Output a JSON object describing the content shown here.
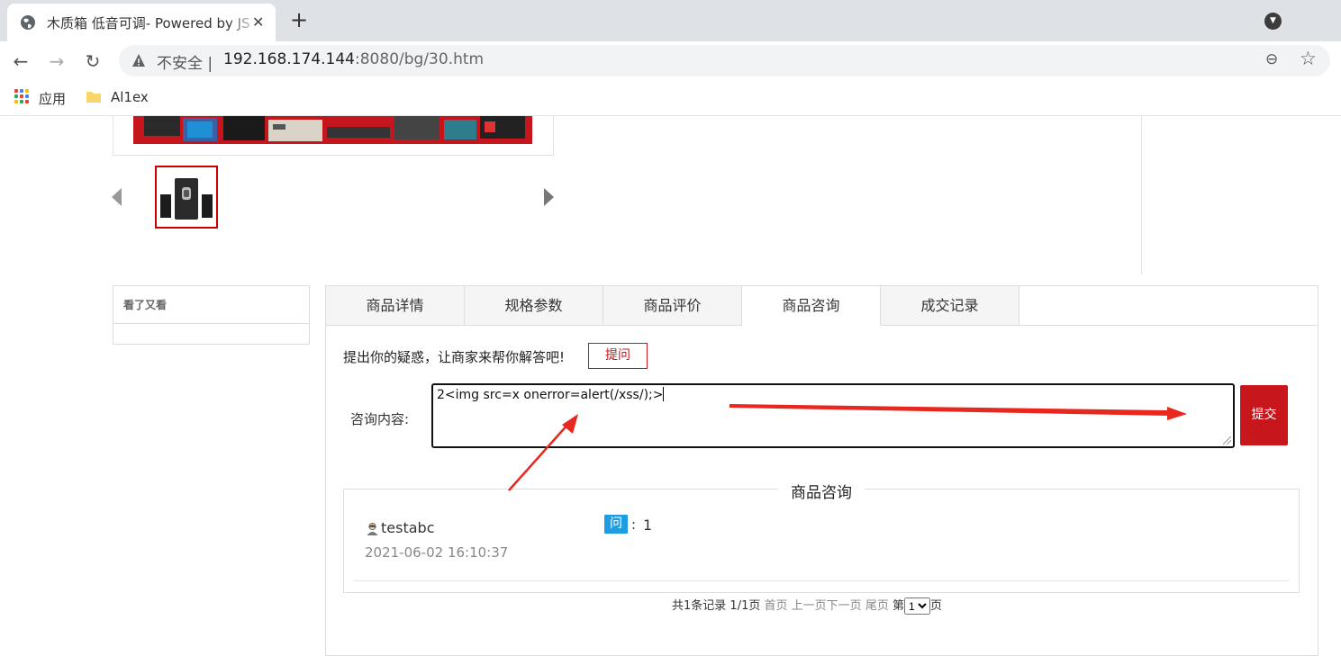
{
  "browser": {
    "tab_title": "木质箱 低音可调- Powered by JS",
    "tab_close": "✕",
    "new_tab": "+",
    "insecure_label": "不安全",
    "url_host": "192.168.174.144",
    "url_path": ":8080/bg/30.htm",
    "bookmarks": [
      {
        "label": "应用"
      },
      {
        "label": "Al1ex"
      }
    ]
  },
  "gallery": {
    "selected_thumbnail": 1
  },
  "sidebar": {
    "title": "看了又看"
  },
  "tabs": [
    {
      "label": "商品详情",
      "active": false
    },
    {
      "label": "规格参数",
      "active": false
    },
    {
      "label": "商品评价",
      "active": false
    },
    {
      "label": "商品咨询",
      "active": true
    },
    {
      "label": "成交记录",
      "active": false
    }
  ],
  "consult": {
    "prompt": "提出你的疑惑，让商家来帮你解答吧!",
    "ask_button": "提问",
    "content_label": "咨询内容:",
    "textarea_value": "2<img src=x onerror=alert(/xss/);>",
    "submit_button": "提交"
  },
  "qa": {
    "section_title": "商品咨询",
    "items": [
      {
        "user": "testabc",
        "date": "2021-06-02 16:10:37",
        "badge": "问",
        "colon": ":",
        "question": "1"
      }
    ]
  },
  "pagination": {
    "total": "共1条记录",
    "pages": "1/1页",
    "first": "首页",
    "prev": "上一页",
    "next": "下一页",
    "last": "尾页",
    "jump_prefix": "第",
    "current_page": "1",
    "jump_suffix": "页"
  },
  "colors": {
    "accent": "#c8161d",
    "badge": "#1e9de3",
    "annotation_arrow": "#e8271f"
  }
}
